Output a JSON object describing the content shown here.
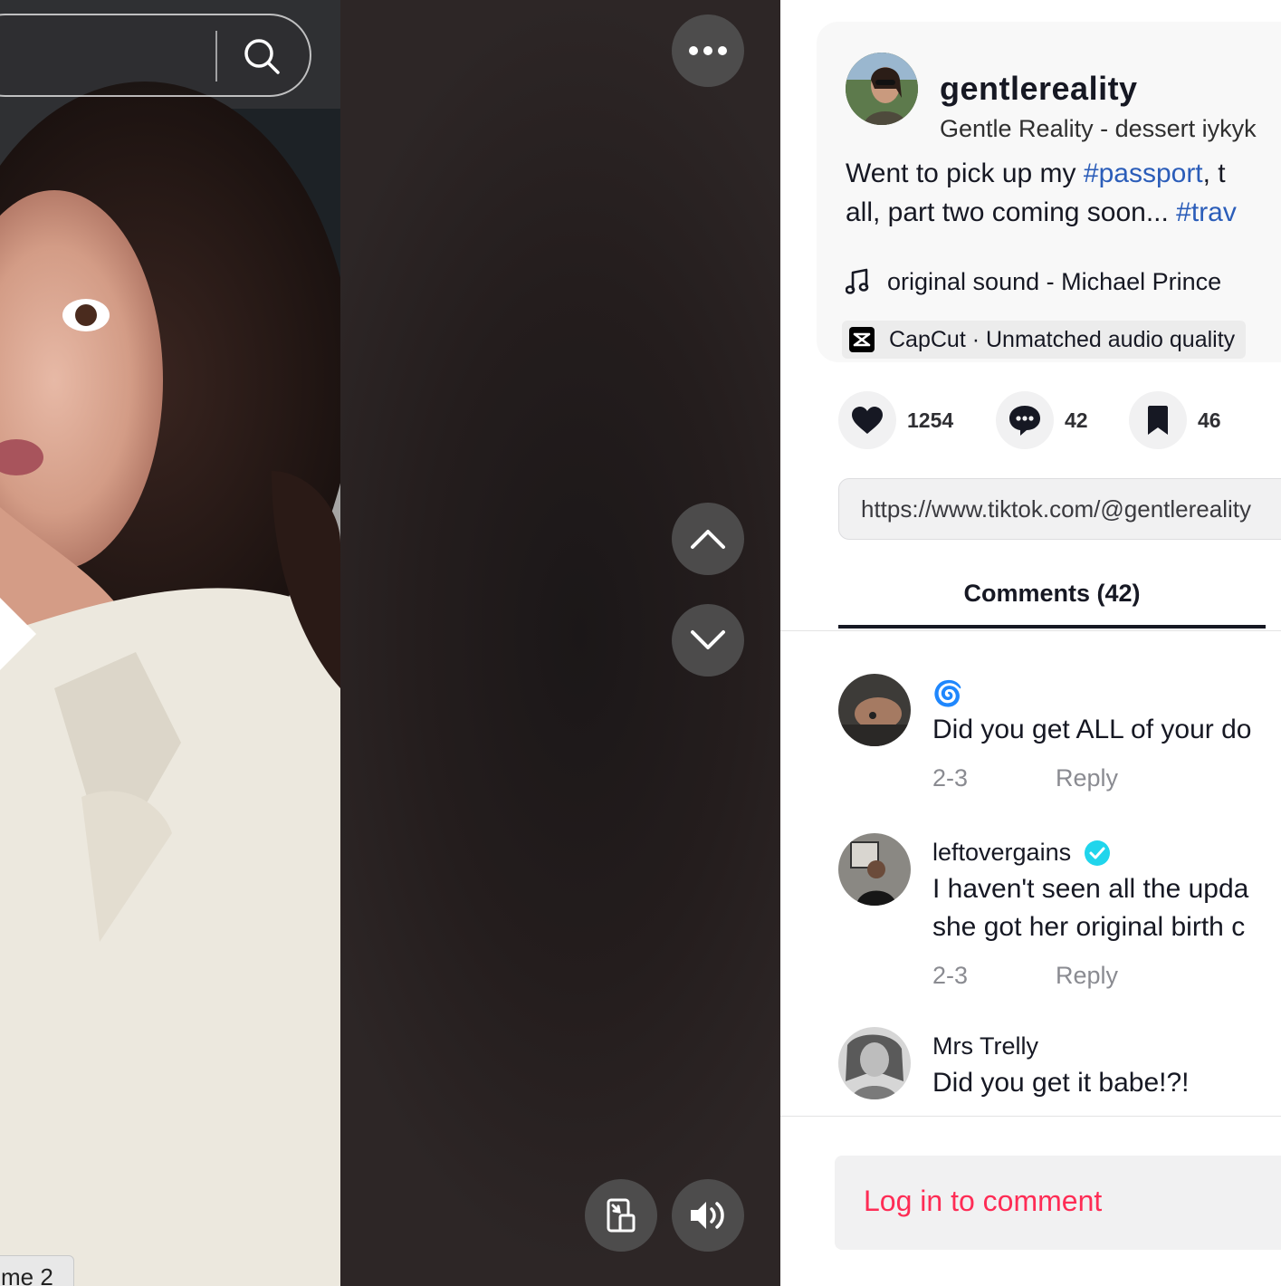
{
  "video": {
    "search_placeholder": "",
    "filter_chip_label": "me 2",
    "more_button_icon": "ellipsis-icon",
    "nav_up_icon": "chevron-up-icon",
    "nav_down_icon": "chevron-down-icon",
    "pip_icon": "picture-in-picture-icon",
    "volume_icon": "volume-icon"
  },
  "author": {
    "handle": "gentlereality",
    "subtitle": "Gentle Reality - dessert iykyk"
  },
  "caption": {
    "line1_prefix": "Went to pick up my ",
    "hashtag1": "#passport",
    "line1_suffix": ", t",
    "line2_prefix": "all, part two coming soon... ",
    "hashtag2": "#trav"
  },
  "music": {
    "label": "original sound - Michael Prince"
  },
  "ad": {
    "label": "CapCut · Unmatched audio quality"
  },
  "actions": {
    "likes": "1254",
    "comments": "42",
    "saves": "46"
  },
  "share_link": "https://www.tiktok.com/@gentlereality",
  "tabs": {
    "comments_label": "Comments (42)"
  },
  "comments": [
    {
      "user": "🌀",
      "verified": false,
      "lines": [
        "Did you get ALL of your do"
      ],
      "date": "2-3",
      "reply": "Reply"
    },
    {
      "user": "leftovergains",
      "verified": true,
      "lines": [
        "I haven't seen all the upda",
        "she got her original birth c"
      ],
      "date": "2-3",
      "reply": "Reply"
    },
    {
      "user": "Mrs Trelly",
      "verified": false,
      "lines": [
        "Did you get it babe!?!"
      ],
      "date": "",
      "reply": ""
    }
  ],
  "login": {
    "label": "Log in to comment"
  },
  "colors": {
    "accent": "#fe2c55",
    "hashtag": "#2b5db9",
    "verified": "#20d5ec"
  }
}
